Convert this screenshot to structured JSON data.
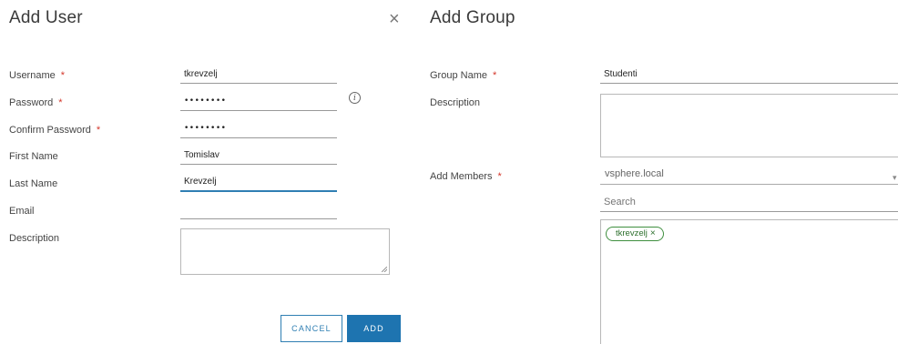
{
  "add_user": {
    "title": "Add User",
    "close_glyph": "×",
    "fields": {
      "username": {
        "label": "Username",
        "required": true,
        "value": "tkrevzelj"
      },
      "password": {
        "label": "Password",
        "required": true,
        "value": "••••••••"
      },
      "confirm_password": {
        "label": "Confirm Password",
        "required": true,
        "value": "••••••••"
      },
      "first_name": {
        "label": "First Name",
        "value": "Tomislav"
      },
      "last_name": {
        "label": "Last Name",
        "value": "Krevzelj"
      },
      "email": {
        "label": "Email",
        "value": ""
      },
      "description": {
        "label": "Description",
        "value": ""
      }
    },
    "required_mark": "*",
    "info_glyph": "i",
    "cancel_label": "CANCEL",
    "add_label": "ADD"
  },
  "add_group": {
    "title": "Add Group",
    "fields": {
      "group_name": {
        "label": "Group Name",
        "required": true,
        "value": "Studenti"
      },
      "description": {
        "label": "Description",
        "value": ""
      },
      "add_members": {
        "label": "Add Members",
        "required": true,
        "domain": "vsphere.local"
      }
    },
    "search_placeholder": "Search",
    "members": [
      {
        "name": "tkrevzelj",
        "remove_glyph": "×"
      }
    ]
  },
  "colors": {
    "accent": "#1e74b0",
    "required": "#d4362a",
    "chip_border": "#3f8f3f"
  },
  "icons": {
    "close": "close-icon",
    "info": "info-icon",
    "chevron": "chevron-down-icon",
    "resize": "resize-grip-icon"
  }
}
